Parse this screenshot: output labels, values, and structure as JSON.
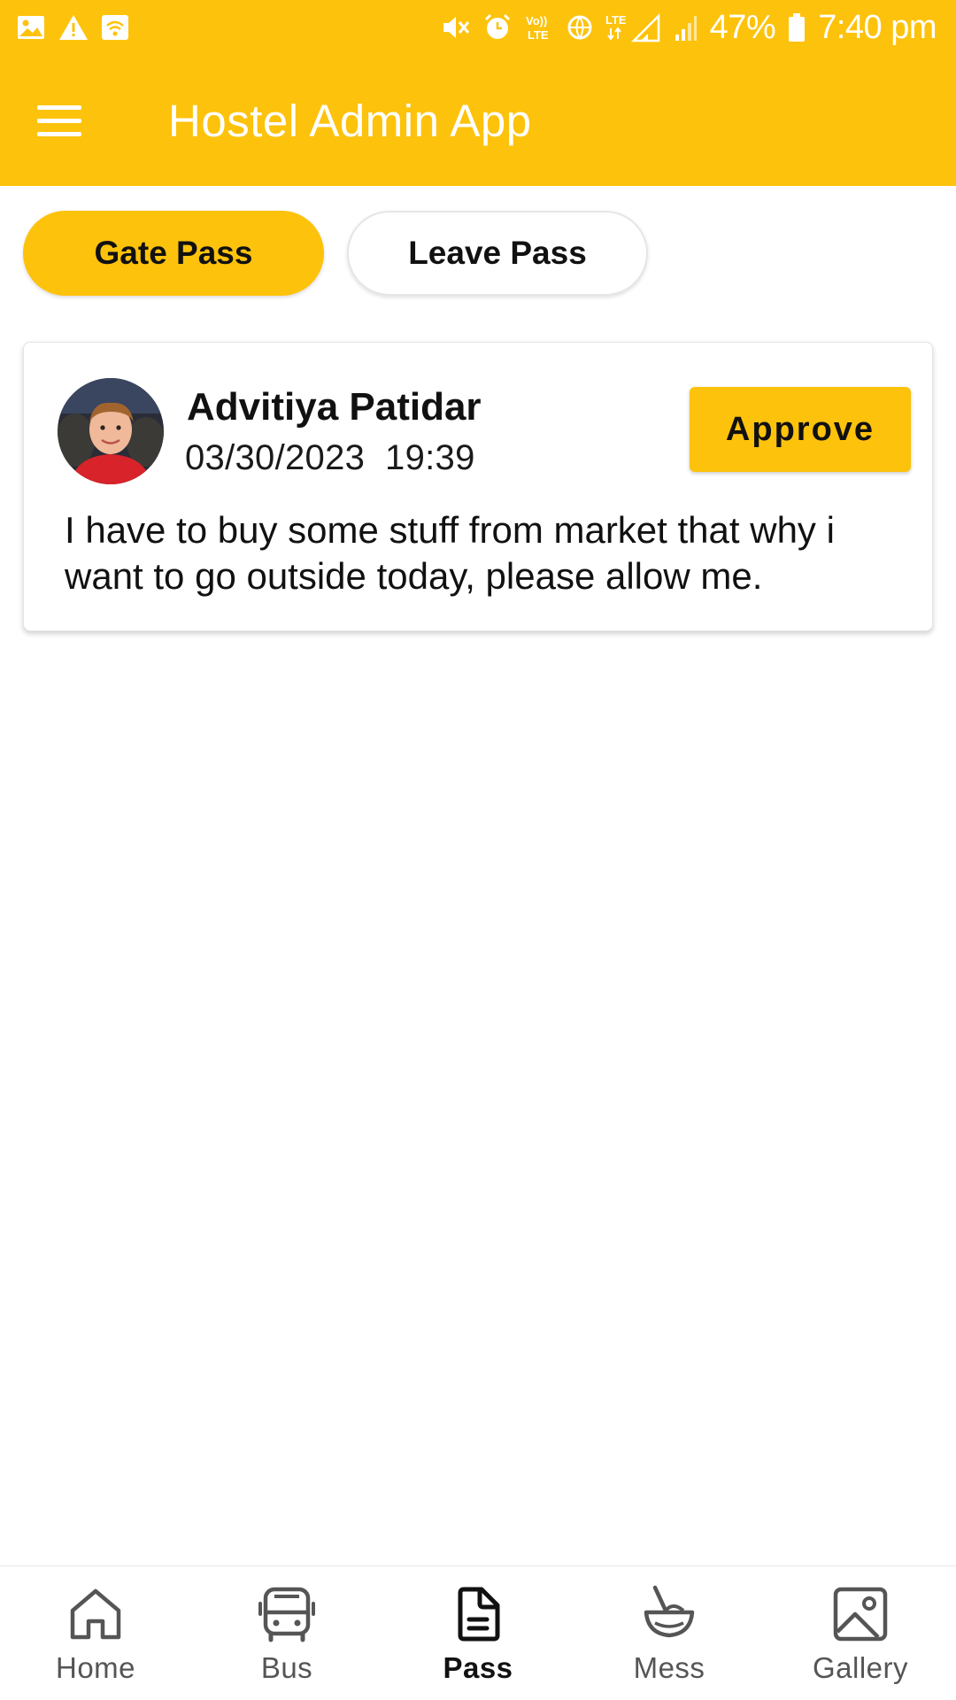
{
  "status_bar": {
    "battery": "47%",
    "time": "7:40 pm",
    "volte_label": "Vo)) LTE",
    "lte_label": "LTE"
  },
  "app_bar": {
    "title": "Hostel Admin App"
  },
  "tabs": [
    {
      "label": "Gate Pass",
      "active": true
    },
    {
      "label": "Leave Pass",
      "active": false
    }
  ],
  "requests": [
    {
      "name": "Advitiya Patidar",
      "date": "03/30/2023",
      "time": "19:39",
      "datetime": "03/30/2023  19:39",
      "reason": "I have to buy some stuff from market that why i want to go outside today, please allow me.",
      "action_label": "Approve"
    }
  ],
  "bottom_nav": [
    {
      "label": "Home",
      "icon": "home-icon",
      "active": false
    },
    {
      "label": "Bus",
      "icon": "bus-icon",
      "active": false
    },
    {
      "label": "Pass",
      "icon": "pass-icon",
      "active": true
    },
    {
      "label": "Mess",
      "icon": "mess-icon",
      "active": false
    },
    {
      "label": "Gallery",
      "icon": "gallery-icon",
      "active": false
    }
  ],
  "colors": {
    "primary": "#FDC20B",
    "text": "#111111",
    "nav_inactive": "#555555"
  }
}
